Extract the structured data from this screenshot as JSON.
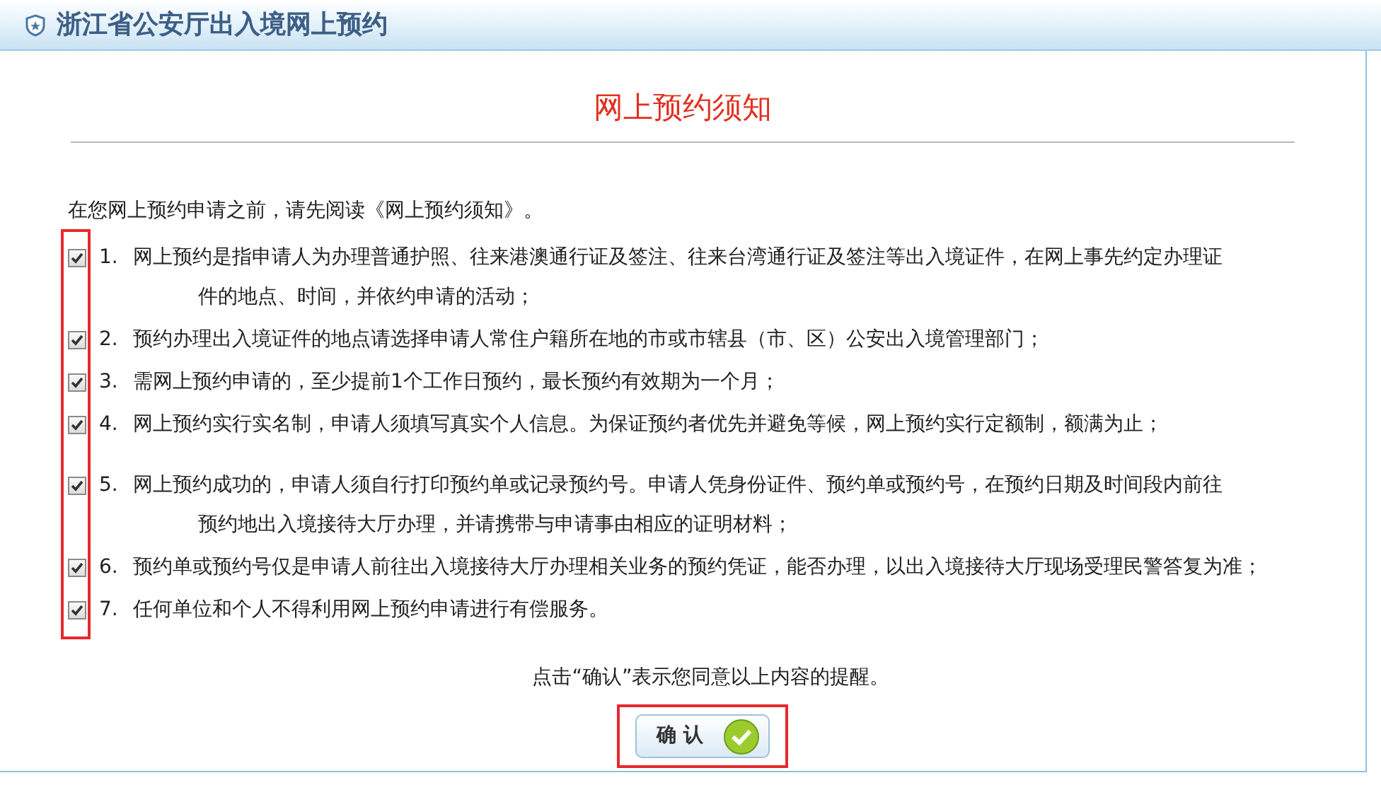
{
  "header": {
    "title": "浙江省公安厅出入境网上预约"
  },
  "notice": {
    "title": "网上预约须知",
    "intro": "在您网上预约申请之前，请先阅读《网上预约须知》。",
    "items": [
      {
        "number": "1.",
        "checked": true,
        "lines": [
          "网上预约是指申请人为办理普通护照、往来港澳通行证及签注、往来台湾通行证及签注等出入境证件，在网上事先约定办理证",
          "件的地点、时间，并依约申请的活动；"
        ]
      },
      {
        "number": "2.",
        "checked": true,
        "lines": [
          "预约办理出入境证件的地点请选择申请人常住户籍所在地的市或市辖县（市、区）公安出入境管理部门；"
        ]
      },
      {
        "number": "3.",
        "checked": true,
        "lines": [
          "需网上预约申请的，至少提前1个工作日预约，最长预约有效期为一个月；"
        ]
      },
      {
        "number": "4.",
        "checked": true,
        "lines": [
          "网上预约实行实名制，申请人须填写真实个人信息。为保证预约者优先并避免等候，网上预约实行定额制，额满为止；"
        ]
      },
      {
        "number": "5.",
        "checked": true,
        "lines": [
          "网上预约成功的，申请人须自行打印预约单或记录预约号。申请人凭身份证件、预约单或预约号，在预约日期及时间段内前往",
          "预约地出入境接待大厅办理，并请携带与申请事由相应的证明材料；"
        ]
      },
      {
        "number": "6.",
        "checked": true,
        "lines": [
          "预约单或预约号仅是申请人前往出入境接待大厅办理相关业务的预约凭证，能否办理，以出入境接待大厅现场受理民警答复为准；"
        ]
      },
      {
        "number": "7.",
        "checked": true,
        "lines": [
          "任何单位和个人不得利用网上预约申请进行有偿服务。"
        ]
      }
    ],
    "confirm_hint": "点击“确认”表示您同意以上内容的提醒。",
    "confirm_button": "确 认"
  }
}
